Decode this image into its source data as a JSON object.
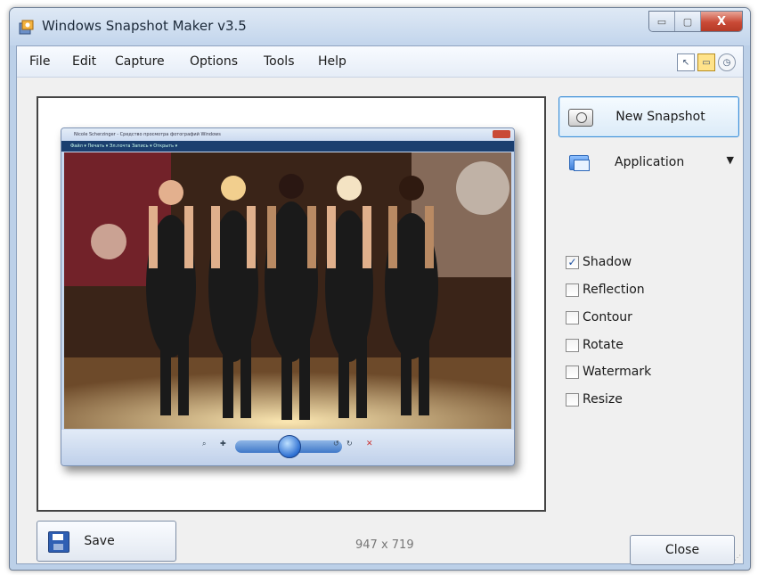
{
  "window": {
    "title": "Windows Snapshot Maker v3.5",
    "caption": {
      "minimize": "▭",
      "maximize": "▢",
      "close": "X"
    }
  },
  "menu": [
    "File",
    "Edit",
    "Capture",
    "Options",
    "Tools",
    "Help"
  ],
  "mode_icons": [
    "cursor-icon",
    "window-mode-icon",
    "timer-icon"
  ],
  "preview": {
    "inner_title": "Nicole Scherzinger - Средство просмотра фотографий Windows",
    "inner_menu": "Файл ▾   Печать ▾   Эл.почта   Запись ▾   Открыть ▾",
    "controls": [
      "⌕",
      "✚",
      "↺",
      "↻",
      "✕"
    ]
  },
  "right": {
    "new_snapshot": "New Snapshot",
    "source": "Application",
    "options": [
      {
        "label": "Shadow",
        "checked": true
      },
      {
        "label": "Reflection",
        "checked": false
      },
      {
        "label": "Contour",
        "checked": false
      },
      {
        "label": "Rotate",
        "checked": false
      },
      {
        "label": "Watermark",
        "checked": false
      },
      {
        "label": "Resize",
        "checked": false
      }
    ]
  },
  "bottom": {
    "save": "Save",
    "dimensions": "947 x 719",
    "close": "Close"
  },
  "colors": {
    "title_bar": "#c2d5ec",
    "close_red": "#c94a36",
    "accent_blue": "#3d8ed6"
  }
}
